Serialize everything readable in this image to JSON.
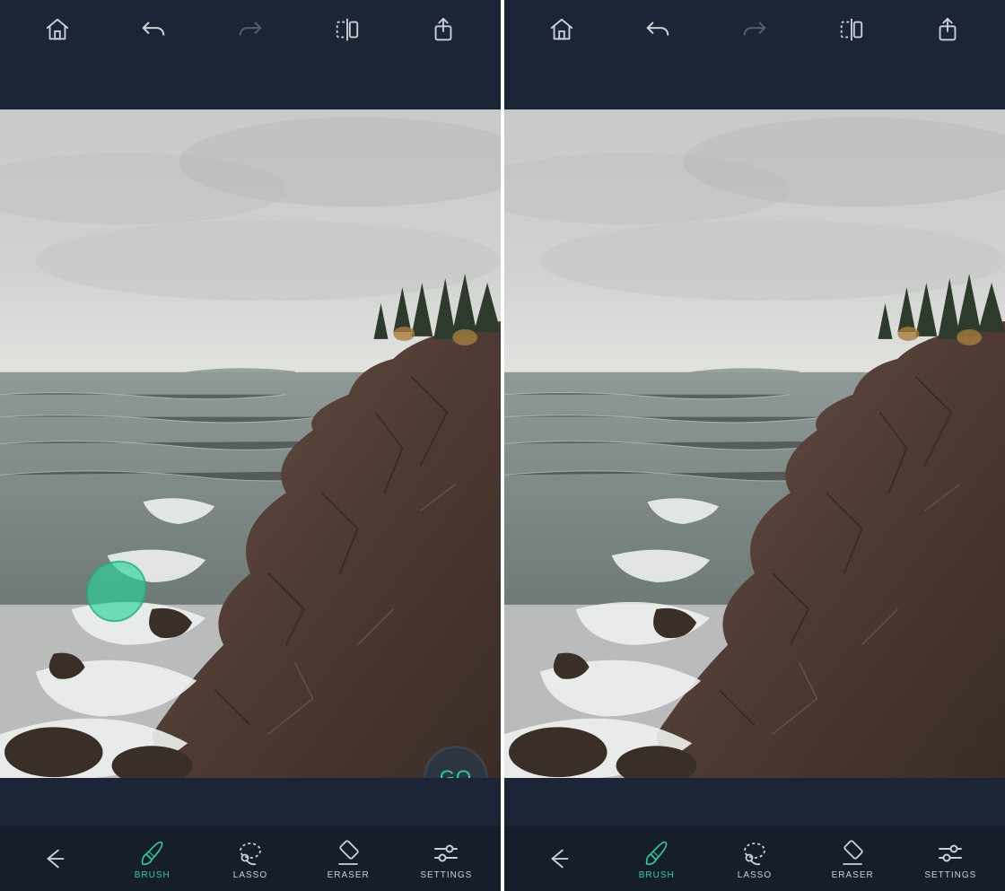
{
  "accent_color": "#29d49a",
  "top": {
    "home": "home-icon",
    "undo": "undo-icon",
    "redo": "redo-icon",
    "compare": "compare-icon",
    "share": "share-icon"
  },
  "action": {
    "go_label": "GO"
  },
  "tools": {
    "back": "back-arrow-icon",
    "brush": "BRUSH",
    "lasso": "LASSO",
    "eraser": "ERASER",
    "settings": "SETTINGS"
  },
  "left_pane": {
    "has_brush_mark": true,
    "show_go": true
  },
  "right_pane": {
    "has_brush_mark": false,
    "show_go": false
  }
}
